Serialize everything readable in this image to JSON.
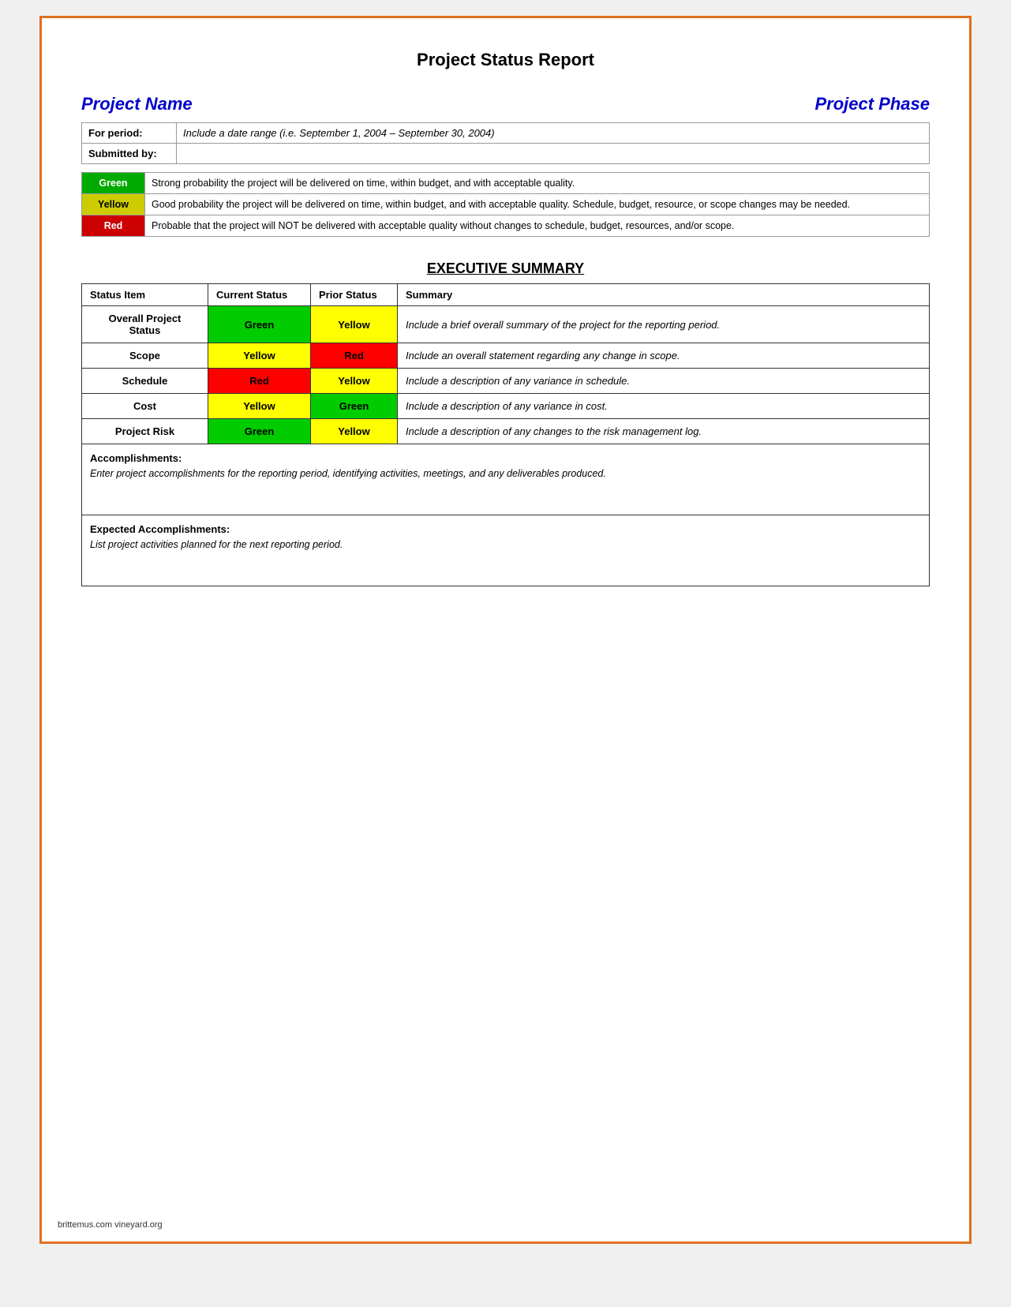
{
  "page": {
    "title": "Project Status Report",
    "border_color": "#e07020"
  },
  "header": {
    "project_name_label": "Project Name",
    "project_phase_label": "Project Phase"
  },
  "info_rows": [
    {
      "label": "For period:",
      "value": "Include a date range (i.e. September 1, 2004 – September 30, 2004)"
    },
    {
      "label": "Submitted by:",
      "value": ""
    }
  ],
  "legend": [
    {
      "color_label": "Green",
      "color_class": "green-cell",
      "description": "Strong probability the project will be delivered on time, within budget, and with acceptable quality."
    },
    {
      "color_label": "Yellow",
      "color_class": "yellow-cell",
      "description": "Good probability the project will be delivered on time, within budget, and with acceptable quality. Schedule, budget, resource, or scope changes may be needed."
    },
    {
      "color_label": "Red",
      "color_class": "red-cell",
      "description": "Probable that the project will NOT be delivered with acceptable quality without changes to schedule, budget, resources, and/or scope."
    }
  ],
  "executive_summary": {
    "section_title": "EXECUTIVE SUMMARY",
    "columns": [
      "Status Item",
      "Current Status",
      "Prior Status",
      "Summary"
    ],
    "rows": [
      {
        "status_item": "Overall Project\nStatus",
        "current_status": "Green",
        "current_class": "green-status",
        "prior_status": "Yellow",
        "prior_class": "yellow-status",
        "summary": "Include a brief overall summary of the project for the reporting period."
      },
      {
        "status_item": "Scope",
        "current_status": "Yellow",
        "current_class": "yellow-status",
        "prior_status": "Red",
        "prior_class": "red-status",
        "summary": "Include an overall statement regarding any change in scope."
      },
      {
        "status_item": "Schedule",
        "current_status": "Red",
        "current_class": "red-status",
        "prior_status": "Yellow",
        "prior_class": "yellow-status",
        "summary": "Include a description of any variance in schedule."
      },
      {
        "status_item": "Cost",
        "current_status": "Yellow",
        "current_class": "yellow-status",
        "prior_status": "Green",
        "prior_class": "green-status",
        "summary": "Include a description of any variance in cost."
      },
      {
        "status_item": "Project Risk",
        "current_status": "Green",
        "current_class": "green-status",
        "prior_status": "Yellow",
        "prior_class": "yellow-status",
        "summary": "Include a description of any changes to the risk management log."
      }
    ]
  },
  "accomplishments": {
    "title": "Accomplishments:",
    "text": "Enter project accomplishments for the reporting period, identifying activities, meetings, and any deliverables produced."
  },
  "expected_accomplishments": {
    "title": "Expected Accomplishments:",
    "text": "List project activities planned for the next reporting period."
  },
  "footer": {
    "text": "brittemus.com      vineyard.org"
  }
}
